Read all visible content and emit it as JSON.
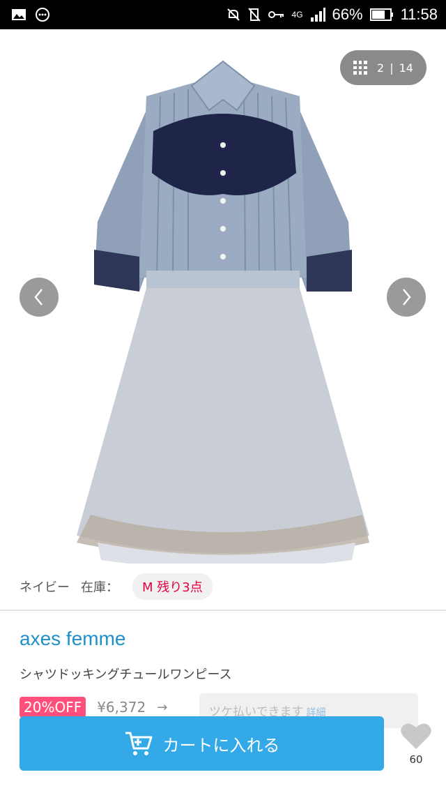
{
  "status_bar": {
    "network": "4G",
    "battery": "66%",
    "time": "11:58",
    "icons": [
      "image-icon",
      "notification-icon",
      "mute-icon",
      "vibrate-off-icon",
      "key-icon",
      "signal-icon",
      "battery-icon"
    ]
  },
  "gallery": {
    "current": "2",
    "separator": "|",
    "total": "14"
  },
  "variant": {
    "color": "ネイビー",
    "stock_label": "在庫：",
    "stock_badge": "M 残り3点"
  },
  "product": {
    "brand": "axes femme",
    "name": "シャツドッキングチュールワンピース"
  },
  "price": {
    "discount": "20%OFF",
    "original": "¥6,372",
    "arrow": "→"
  },
  "payment": {
    "text": "ツケ払いできます",
    "detail": "詳細"
  },
  "cart": {
    "label": "カートに入れる"
  },
  "favorite": {
    "count": "60"
  },
  "colors": {
    "brand": "#1e90c8",
    "cart_button": "#33a9e8",
    "discount": "#ff4f7a",
    "stock_text": "#e6003c"
  }
}
